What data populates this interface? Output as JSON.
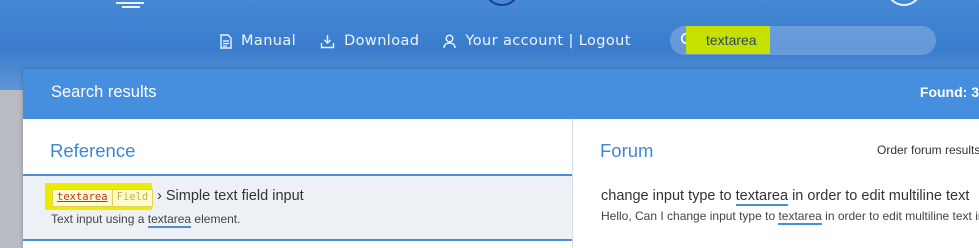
{
  "nav": {
    "manual": "Manual",
    "download": "Download",
    "account": "Your account | Logout"
  },
  "search": {
    "value": "textarea"
  },
  "results": {
    "title": "Search results",
    "found": "Found: 3"
  },
  "reference": {
    "heading": "Reference",
    "item": {
      "tag": "textarea",
      "type": "Field",
      "title": "› Simple text field input",
      "desc_before": "Text input using a ",
      "desc_term": "textarea",
      "desc_after": " element."
    }
  },
  "forum": {
    "heading": "Forum",
    "order_label": "Order forum results",
    "item": {
      "title_before": "change input type to ",
      "title_term": "textarea",
      "title_after": " in order to edit multiline text",
      "snippet_before": "Hello, Can I change input type to ",
      "snippet_term": "textarea",
      "snippet_after": " in order to edit multiline text in th"
    }
  },
  "colors": {
    "header_blue": "#468ede",
    "accent_blue": "#3f87d6",
    "highlight_yellow": "#ecec00"
  }
}
